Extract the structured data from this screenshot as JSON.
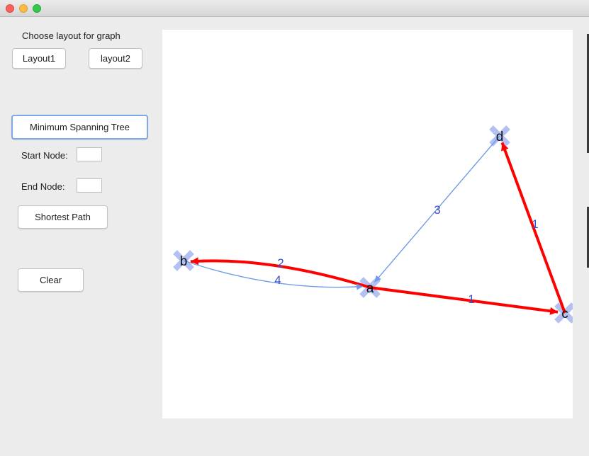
{
  "window": {
    "controls": [
      "close-dot",
      "minimize-dot",
      "zoom-dot"
    ]
  },
  "sidebar": {
    "layout_heading": "Choose layout for graph",
    "layout1_label": "Layout1",
    "layout2_label": "layout2",
    "mst_label": "Minimum Spanning Tree",
    "start_node_label": "Start Node:",
    "start_node_value": "",
    "end_node_label": "End Node:",
    "end_node_value": "",
    "shortest_path_label": "Shortest Path",
    "clear_label": "Clear"
  },
  "graph": {
    "highlight_color": "#ff0000",
    "edge_color": "#6f9ce6",
    "weight_color": "#3a4fc8",
    "node_marker_color": "#b3c0f2",
    "nodes": [
      {
        "id": "b",
        "label": "b"
      },
      {
        "id": "a",
        "label": "a"
      },
      {
        "id": "d",
        "label": "d"
      },
      {
        "id": "c",
        "label": "c"
      }
    ],
    "edges": [
      {
        "from": "a",
        "to": "b",
        "weight": "2",
        "highlighted": true
      },
      {
        "from": "b",
        "to": "a",
        "weight": "4",
        "highlighted": false
      },
      {
        "from": "d",
        "to": "a",
        "weight": "3",
        "highlighted": false
      },
      {
        "from": "c",
        "to": "d",
        "weight": "1",
        "highlighted": true
      },
      {
        "from": "a",
        "to": "c",
        "weight": "1",
        "highlighted": true
      }
    ]
  }
}
